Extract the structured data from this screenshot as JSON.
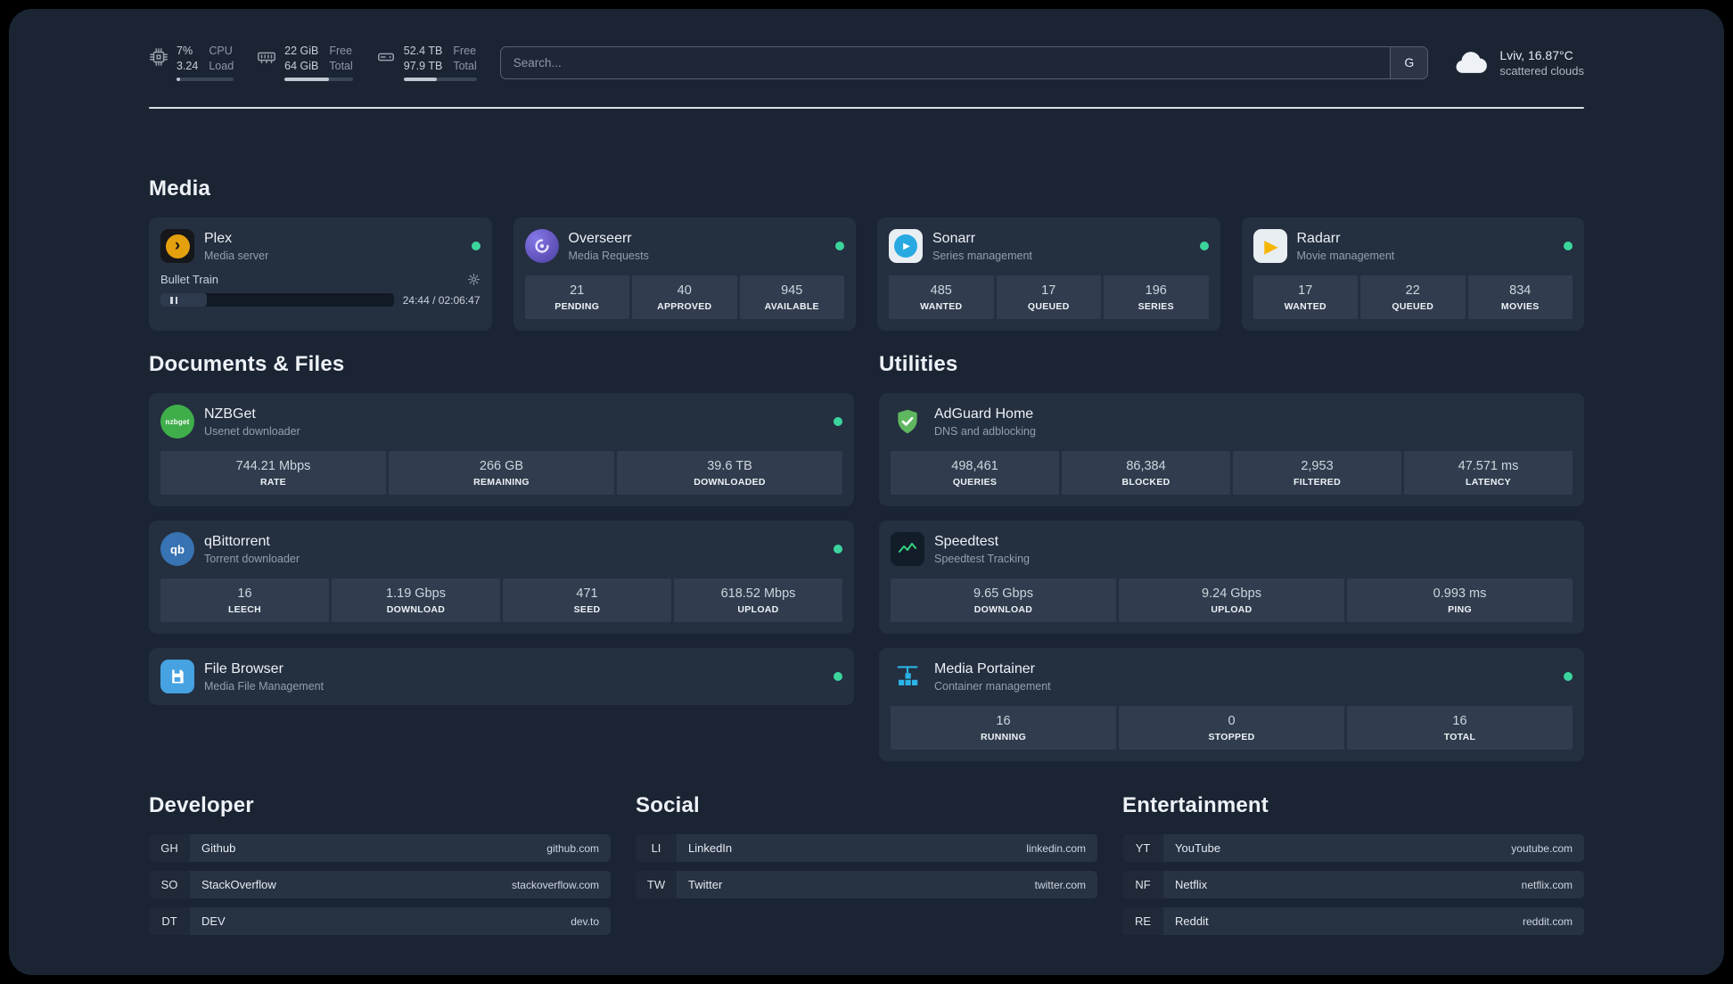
{
  "colors": {
    "page_background": "#1a2433",
    "card_background": "#242f40",
    "stat_background": "#313d4e",
    "status_online": "#3bd49d",
    "plex_accent": "#e5a00d",
    "divider": "#d9dfe7"
  },
  "icons": {
    "cpu": "cpu-chip",
    "ram": "memory-module",
    "disk": "hard-drive",
    "search_provider": "google",
    "weather": "cloud",
    "plex": "plex-chevron",
    "overseerr": "overseerr-swirl",
    "sonarr": "sonarr-play",
    "radarr": "radarr-play",
    "nzbget": "nzbget-circle",
    "qbittorrent": "qbittorrent-circle",
    "filebrowser": "floppy-disk",
    "adguard": "shield-check",
    "speedtest": "graph-line",
    "portainer": "container-crane"
  },
  "topbar": {
    "cpu": {
      "value1": "7%",
      "value2": "3.24",
      "label1": "CPU",
      "label2": "Load",
      "bar_percent": 7
    },
    "ram": {
      "value1": "22 GiB",
      "value2": "64 GiB",
      "label1": "Free",
      "label2": "Total",
      "bar_percent": 65
    },
    "disk": {
      "value1": "52.4 TB",
      "value2": "97.9 TB",
      "label1": "Free",
      "label2": "Total",
      "bar_percent": 46
    },
    "search": {
      "placeholder": "Search...",
      "button": "G"
    },
    "weather": {
      "location": "Lviv, 16.87°C",
      "condition": "scattered clouds"
    }
  },
  "sections": {
    "media": {
      "title": "Media",
      "services": [
        {
          "name": "Plex",
          "subtitle": "Media server",
          "status": "online",
          "player": {
            "track": "Bullet Train",
            "time": "24:44 / 02:06:47",
            "progress_percent": 20
          }
        },
        {
          "name": "Overseerr",
          "subtitle": "Media Requests",
          "status": "online",
          "stats": [
            {
              "value": "21",
              "label": "PENDING"
            },
            {
              "value": "40",
              "label": "APPROVED"
            },
            {
              "value": "945",
              "label": "AVAILABLE"
            }
          ]
        },
        {
          "name": "Sonarr",
          "subtitle": "Series management",
          "status": "online",
          "stats": [
            {
              "value": "485",
              "label": "WANTED"
            },
            {
              "value": "17",
              "label": "QUEUED"
            },
            {
              "value": "196",
              "label": "SERIES"
            }
          ]
        },
        {
          "name": "Radarr",
          "subtitle": "Movie management",
          "status": "online",
          "stats": [
            {
              "value": "17",
              "label": "WANTED"
            },
            {
              "value": "22",
              "label": "QUEUED"
            },
            {
              "value": "834",
              "label": "MOVIES"
            }
          ]
        }
      ]
    },
    "documents": {
      "title": "Documents & Files",
      "services": [
        {
          "name": "NZBGet",
          "subtitle": "Usenet downloader",
          "status": "online",
          "icon_text": "nzbget",
          "stats": [
            {
              "value": "744.21 Mbps",
              "label": "RATE"
            },
            {
              "value": "266 GB",
              "label": "REMAINING"
            },
            {
              "value": "39.6 TB",
              "label": "DOWNLOADED"
            }
          ]
        },
        {
          "name": "qBittorrent",
          "subtitle": "Torrent downloader",
          "status": "online",
          "icon_text": "qb",
          "stats": [
            {
              "value": "16",
              "label": "LEECH"
            },
            {
              "value": "1.19 Gbps",
              "label": "DOWNLOAD"
            },
            {
              "value": "471",
              "label": "SEED"
            },
            {
              "value": "618.52 Mbps",
              "label": "UPLOAD"
            }
          ]
        },
        {
          "name": "File Browser",
          "subtitle": "Media File Management",
          "status": "online"
        }
      ]
    },
    "utilities": {
      "title": "Utilities",
      "services": [
        {
          "name": "AdGuard Home",
          "subtitle": "DNS and adblocking",
          "stats": [
            {
              "value": "498,461",
              "label": "QUERIES"
            },
            {
              "value": "86,384",
              "label": "BLOCKED"
            },
            {
              "value": "2,953",
              "label": "FILTERED"
            },
            {
              "value": "47.571 ms",
              "label": "LATENCY"
            }
          ]
        },
        {
          "name": "Speedtest",
          "subtitle": "Speedtest Tracking",
          "stats": [
            {
              "value": "9.65 Gbps",
              "label": "DOWNLOAD"
            },
            {
              "value": "9.24 Gbps",
              "label": "UPLOAD"
            },
            {
              "value": "0.993 ms",
              "label": "PING"
            }
          ]
        },
        {
          "name": "Media Portainer",
          "subtitle": "Container management",
          "status": "online",
          "stats": [
            {
              "value": "16",
              "label": "RUNNING"
            },
            {
              "value": "0",
              "label": "STOPPED"
            },
            {
              "value": "16",
              "label": "TOTAL"
            }
          ]
        }
      ]
    },
    "developer": {
      "title": "Developer",
      "bookmarks": [
        {
          "abbr": "GH",
          "name": "Github",
          "url": "github.com"
        },
        {
          "abbr": "SO",
          "name": "StackOverflow",
          "url": "stackoverflow.com"
        },
        {
          "abbr": "DT",
          "name": "DEV",
          "url": "dev.to"
        }
      ]
    },
    "social": {
      "title": "Social",
      "bookmarks": [
        {
          "abbr": "LI",
          "name": "LinkedIn",
          "url": "linkedin.com"
        },
        {
          "abbr": "TW",
          "name": "Twitter",
          "url": "twitter.com"
        }
      ]
    },
    "entertainment": {
      "title": "Entertainment",
      "bookmarks": [
        {
          "abbr": "YT",
          "name": "YouTube",
          "url": "youtube.com"
        },
        {
          "abbr": "NF",
          "name": "Netflix",
          "url": "netflix.com"
        },
        {
          "abbr": "RE",
          "name": "Reddit",
          "url": "reddit.com"
        }
      ]
    }
  }
}
